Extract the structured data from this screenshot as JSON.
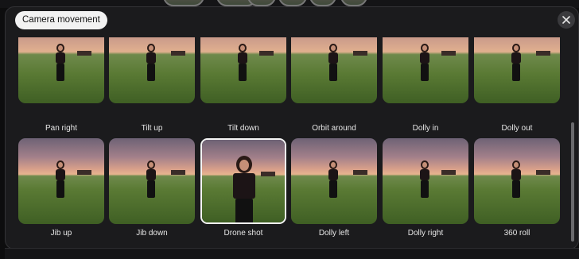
{
  "header": {
    "tag_label": "Camera movement",
    "close_icon": "close-icon"
  },
  "presets": [
    {
      "label": "Pan right",
      "selected": false
    },
    {
      "label": "Tilt up",
      "selected": false
    },
    {
      "label": "Tilt down",
      "selected": false
    },
    {
      "label": "Orbit around",
      "selected": false
    },
    {
      "label": "Dolly in",
      "selected": false
    },
    {
      "label": "Dolly out",
      "selected": false
    },
    {
      "label": "Jib up",
      "selected": false
    },
    {
      "label": "Jib down",
      "selected": false
    },
    {
      "label": "Drone shot",
      "selected": true
    },
    {
      "label": "Dolly left",
      "selected": false
    },
    {
      "label": "Dolly right",
      "selected": false
    },
    {
      "label": "360 roll",
      "selected": false
    }
  ],
  "colors": {
    "panel_bg": "#1b1b1d",
    "selected_border": "#f4f4f4",
    "tag_bg": "#f2f2f2"
  }
}
